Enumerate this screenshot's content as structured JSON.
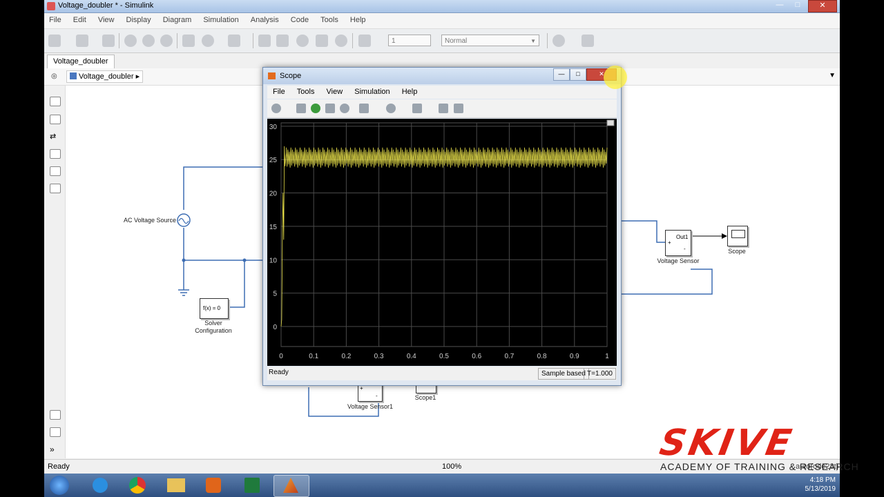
{
  "window": {
    "title": "Voltage_doubler * - Simulink"
  },
  "menu": [
    "File",
    "Edit",
    "View",
    "Display",
    "Diagram",
    "Simulation",
    "Analysis",
    "Code",
    "Tools",
    "Help"
  ],
  "toolbar": {
    "stop_time": "1",
    "sim_mode": "Normal"
  },
  "tab": {
    "label": "Voltage_doubler"
  },
  "breadcrumb": {
    "label": "Voltage_doubler"
  },
  "blocks": {
    "ac_source": "AC Voltage Source",
    "solver_block": "f(x) = 0",
    "solver_label1": "Solver",
    "solver_label2": "Configuration",
    "voltage_sensor_port": "Out1",
    "voltage_sensor": "Voltage Sensor",
    "scope": "Scope",
    "voltage_sensor1": "Voltage Sensor1",
    "scope1": "Scope1",
    "plus": "+",
    "minus": "-"
  },
  "status": {
    "left": "Ready",
    "center": "100%",
    "solver": "auto(ode23t)"
  },
  "scope_window": {
    "title": "Scope",
    "menu": [
      "File",
      "Tools",
      "View",
      "Simulation",
      "Help"
    ],
    "status_left": "Ready",
    "status_mode": "Sample based",
    "status_time": "T=1.000"
  },
  "chart_data": {
    "type": "line",
    "title": "",
    "xlabel": "",
    "ylabel": "",
    "xlim": [
      0,
      1
    ],
    "ylim": [
      -3,
      30.5
    ],
    "x_ticks": [
      "0",
      "0.1",
      "0.2",
      "0.3",
      "0.4",
      "0.5",
      "0.6",
      "0.7",
      "0.8",
      "0.9",
      "1"
    ],
    "y_ticks": [
      "0",
      "5",
      "10",
      "15",
      "20",
      "25",
      "30"
    ],
    "grid": true,
    "series": [
      {
        "color": "#e8e04a",
        "x": [
          0,
          0.002,
          0.004,
          0.006,
          0.008,
          0.01,
          0.012,
          0.016,
          1.0
        ],
        "y": [
          0,
          1,
          14,
          20,
          13,
          27,
          24,
          26,
          25.5
        ],
        "ripple_band": [
          23.8,
          26.8
        ]
      }
    ]
  },
  "taskbar": {
    "time": "4:18 PM",
    "date": "5/13/2019"
  },
  "overlay": {
    "brand": "SKIVE",
    "tagline": "ACADEMY OF TRAINING & RESEARCH"
  },
  "colors": {
    "wire": "#3d6db3",
    "plot_bg": "#000000",
    "trace": "#e8e04a",
    "brand_red": "#e02316"
  }
}
